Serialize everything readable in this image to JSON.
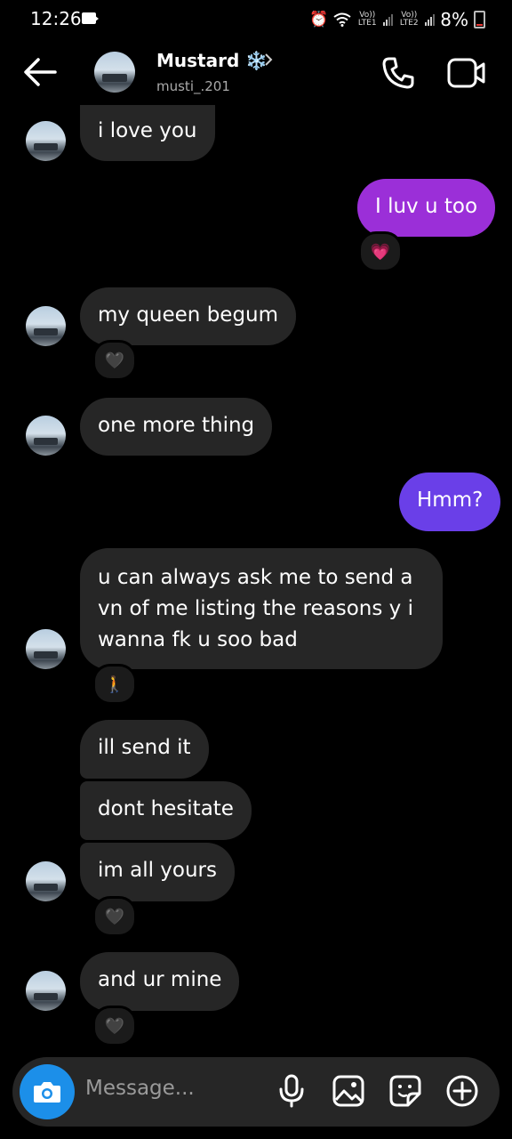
{
  "status_bar": {
    "time": "12:26",
    "sim1_label": "Vo)) LTE1",
    "sim2_label": "Vo)) LTE2",
    "battery": "8%"
  },
  "header": {
    "name": "Mustard ❄️",
    "handle": "musti_.201"
  },
  "messages": [
    {
      "side": "in",
      "text": "i love you"
    },
    {
      "side": "out",
      "text": "I luv  u too",
      "reaction": "💗"
    },
    {
      "side": "in",
      "text": "my queen begum",
      "reaction": "🖤"
    },
    {
      "side": "in",
      "text": "one more thing"
    },
    {
      "side": "out",
      "text": "Hmm?"
    },
    {
      "side": "in",
      "text": "u can always ask me to send a",
      "text2": "vn of me listing the reasons y i",
      "text3": "wanna fk u soo bad",
      "reaction": "🚶"
    },
    {
      "side": "in",
      "text": "ill send it"
    },
    {
      "side": "in",
      "text": "dont hesitate"
    },
    {
      "side": "in",
      "text": "im all yours",
      "reaction": "🖤"
    },
    {
      "side": "in",
      "text": "and ur mine",
      "reaction": "🖤"
    }
  ],
  "composer": {
    "placeholder": "Message..."
  },
  "colors": {
    "outgoing_bubble_top": "#9b2fd8",
    "outgoing_bubble_bottom": "#6a3fe8",
    "incoming_bubble": "#262626",
    "camera_button": "#1c8fe9"
  }
}
